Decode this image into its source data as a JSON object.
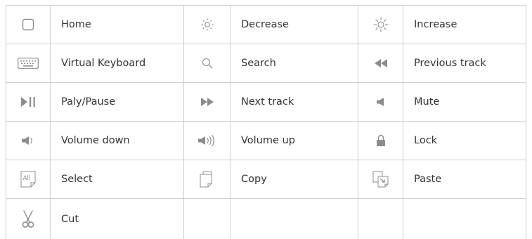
{
  "rows": [
    [
      {
        "icon": "home-icon",
        "label": "Home"
      },
      {
        "icon": "brightness-decrease-icon",
        "label": "Decrease"
      },
      {
        "icon": "brightness-increase-icon",
        "label": "Increase"
      }
    ],
    [
      {
        "icon": "virtual-keyboard-icon",
        "label": "Virtual Keyboard"
      },
      {
        "icon": "search-icon",
        "label": "Search"
      },
      {
        "icon": "previous-track-icon",
        "label": "Previous track"
      }
    ],
    [
      {
        "icon": "play-pause-icon",
        "label": "Paly/Pause"
      },
      {
        "icon": "next-track-icon",
        "label": "Next track"
      },
      {
        "icon": "mute-icon",
        "label": "Mute"
      }
    ],
    [
      {
        "icon": "volume-down-icon",
        "label": "Volume down"
      },
      {
        "icon": "volume-up-icon",
        "label": "Volume up"
      },
      {
        "icon": "lock-icon",
        "label": "Lock"
      }
    ],
    [
      {
        "icon": "select-all-icon",
        "icon_text": "All",
        "label": "Select"
      },
      {
        "icon": "copy-icon",
        "label": "Copy"
      },
      {
        "icon": "paste-icon",
        "label": "Paste"
      }
    ],
    [
      {
        "icon": "cut-icon",
        "label": "Cut"
      },
      {
        "icon": "",
        "label": ""
      },
      {
        "icon": "",
        "label": ""
      }
    ]
  ],
  "colors": {
    "border": "#cfcfcf",
    "icon": "#8c8c8c",
    "text": "#333333"
  }
}
